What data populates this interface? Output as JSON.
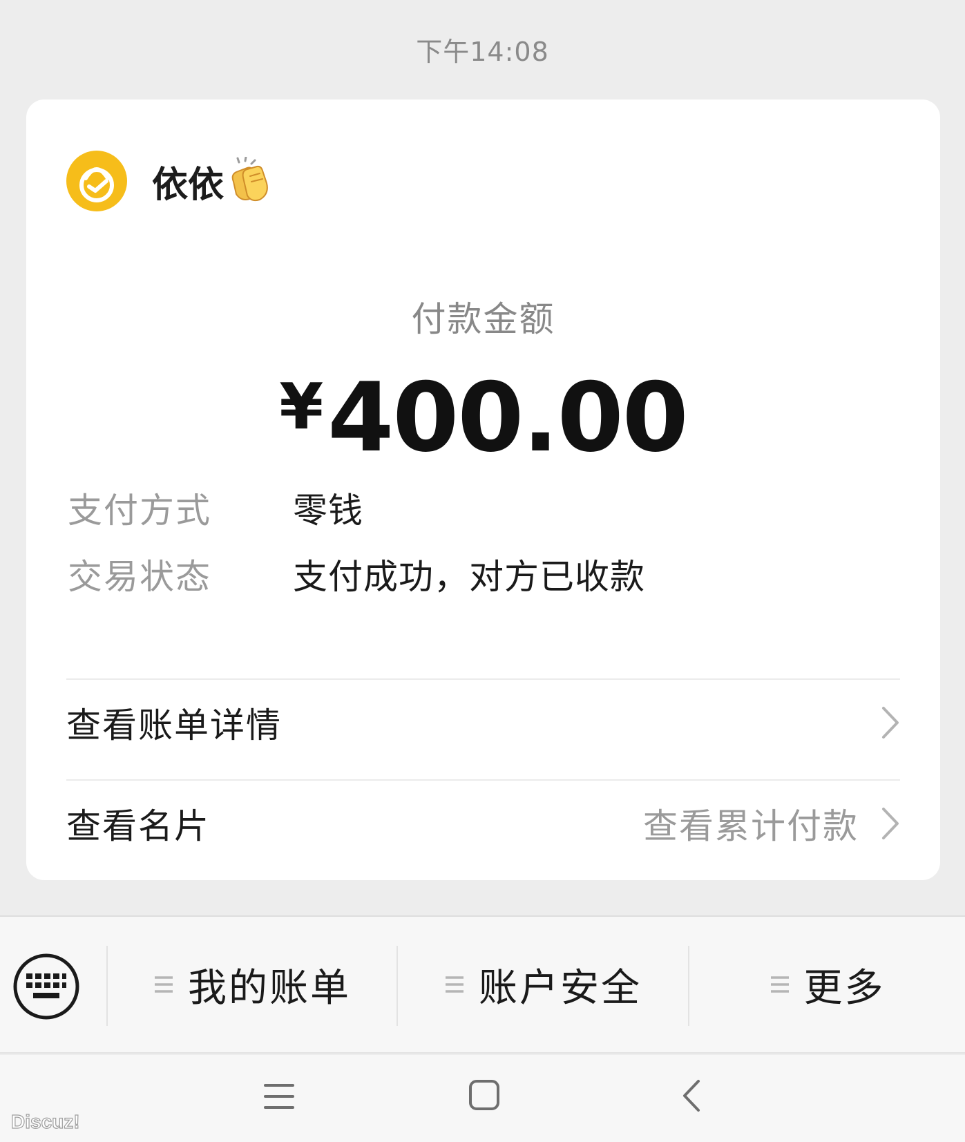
{
  "message": {
    "timestamp": "下午14:08"
  },
  "card": {
    "merchant": {
      "name": "依依",
      "name_emoji": "clapping-hands-icon",
      "logo_icon": "wallet-badge-icon",
      "logo_color": "#f6bd1a"
    },
    "amount_label": "付款金额",
    "currency_symbol": "¥",
    "amount": "400.00",
    "details": [
      {
        "key": "支付方式",
        "value": "零钱"
      },
      {
        "key": "交易状态",
        "value": "支付成功，对方已收款"
      }
    ],
    "links": {
      "bill_details": "查看账单详情",
      "view_card": "查看名片",
      "view_total": "查看累计付款"
    }
  },
  "bottom_menu": {
    "keyboard_icon": "keyboard-icon",
    "items": [
      {
        "label": "我的账单"
      },
      {
        "label": "账户安全"
      },
      {
        "label": "更多"
      }
    ]
  },
  "system_nav": {
    "menu_icon": "menu-icon",
    "home_icon": "home-square-icon",
    "back_icon": "back-chevron-icon"
  },
  "watermark": "Discuz!",
  "colors": {
    "background": "#ededed",
    "card": "#ffffff",
    "accent": "#f6bd1a"
  }
}
